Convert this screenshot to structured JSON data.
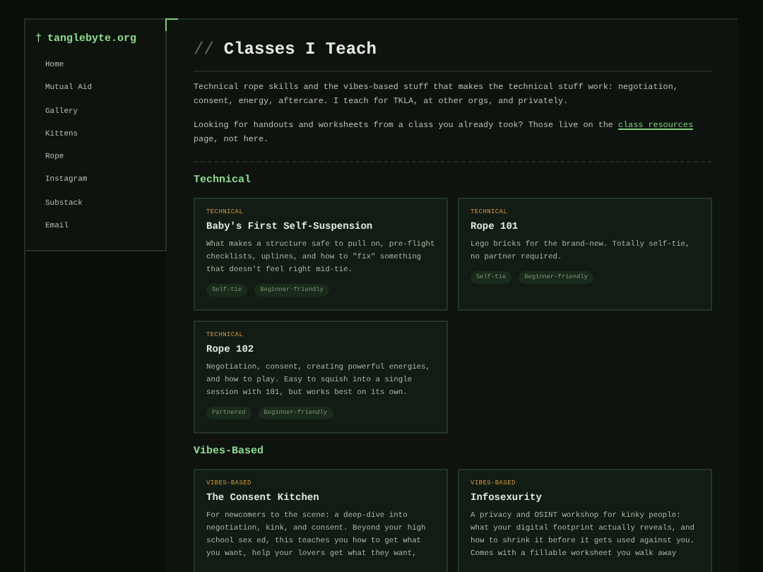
{
  "sidebar": {
    "brand_icon": "†",
    "brand": "tanglebyte.org",
    "items": [
      {
        "label": "Home"
      },
      {
        "label": "Mutual Aid"
      },
      {
        "label": "Gallery"
      },
      {
        "label": "Kittens"
      },
      {
        "label": "Rope"
      },
      {
        "label": "Instagram"
      },
      {
        "label": "Substack"
      },
      {
        "label": "Email"
      }
    ]
  },
  "page": {
    "title_prefix": "//",
    "title": "Classes I Teach",
    "intro": "Technical rope skills and the vibes-based stuff that makes the technical stuff work: negotiation, consent, energy, aftercare. I teach for TKLA, at other orgs, and privately.",
    "note_before": "Looking for handouts and worksheets from a class you already took? Those live on the ",
    "note_link": "class resources",
    "note_after": " page, not here."
  },
  "sections": [
    {
      "heading": "Technical",
      "cards": [
        {
          "kicker": "TECHNICAL",
          "title": "Baby's First Self-Suspension",
          "description": "What makes a structure safe to pull on, pre-flight checklists, uplines, and how to \"fix\" something that doesn't feel right mid-tie.",
          "tags": [
            "Self-tie",
            "Beginner-friendly"
          ]
        },
        {
          "kicker": "TECHNICAL",
          "title": "Rope 101",
          "description": "Lego bricks for the brand-new. Totally self-tie, no partner required.",
          "tags": [
            "Self-tie",
            "Beginner-friendly"
          ]
        },
        {
          "kicker": "TECHNICAL",
          "title": "Rope 102",
          "description": "Negotiation, consent, creating powerful energies, and how to play. Easy to squish into a single session with 101, but works best on its own.",
          "tags": [
            "Partnered",
            "Beginner-friendly"
          ]
        }
      ]
    },
    {
      "heading": "Vibes-Based",
      "cards": [
        {
          "kicker": "VIBES-BASED",
          "title": "The Consent Kitchen",
          "description": "For newcomers to the scene: a deep-dive into negotiation, kink, and consent. Beyond your high school sex ed, this teaches you how to get what you want, help your lovers get what they want,"
        },
        {
          "kicker": "VIBES-BASED",
          "title": "Infosexurity",
          "description": "A privacy and OSINT workshop for kinky people: what your digital footprint actually reveals, and how to shrink it before it gets used against you. Comes with a fillable worksheet you walk away"
        }
      ]
    }
  ]
}
